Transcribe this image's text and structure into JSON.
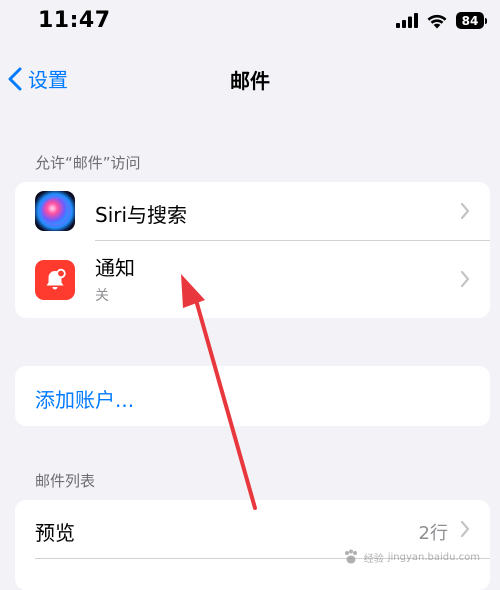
{
  "status_bar": {
    "time": "11:47",
    "battery": "84",
    "icons": [
      "cellular-signal-icon",
      "wifi-icon",
      "battery-icon"
    ]
  },
  "nav": {
    "back_label": "设置",
    "title": "邮件"
  },
  "sections": {
    "allow_access_header": "允许“邮件”访问",
    "mail_list_header": "邮件列表"
  },
  "access_items": [
    {
      "label": "Siri与搜索",
      "icon": "siri-icon"
    },
    {
      "label": "通知",
      "subtitle": "关",
      "icon": "notification-bell-icon"
    }
  ],
  "add_account": {
    "label": "添加账户..."
  },
  "mail_list": {
    "preview_label": "预览",
    "preview_value": "2行"
  },
  "watermark": {
    "text": "jingyan.baidu.com",
    "brand": "经验"
  },
  "colors": {
    "accent": "#007aff",
    "background": "#f2f2f7",
    "notification_red": "#ff3b30",
    "annotation_arrow": "#e8383d"
  }
}
